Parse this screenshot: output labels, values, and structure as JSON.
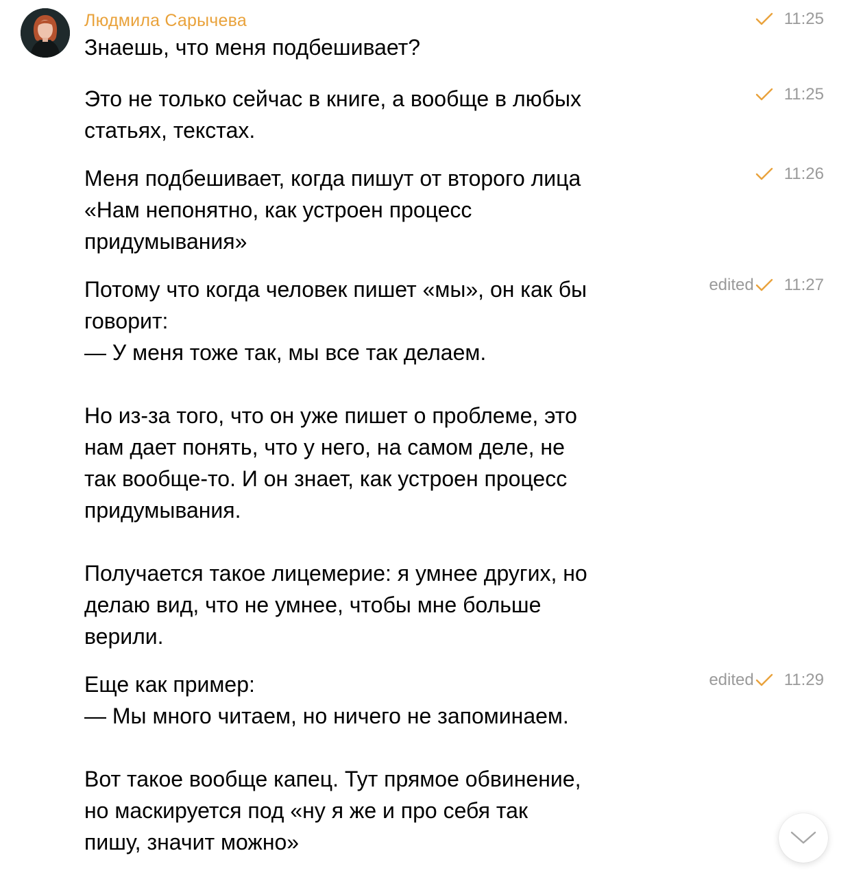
{
  "chat": {
    "sender_name": "Людмила Сарычева",
    "accent_color": "#e9a23b",
    "messages": [
      {
        "text": "Знаешь, что меня подбешивает?",
        "edited": "",
        "time": "11:25",
        "status_icon": "check-icon"
      },
      {
        "text": "Это не только сейчас в книге, а вообще в любых\nстатьях, текстах.",
        "edited": "",
        "time": "11:25",
        "status_icon": "check-icon"
      },
      {
        "text": "Меня подбешивает, когда пишут от второго лица\n«Нам непонятно, как устроен процесс\nпридумывания»",
        "edited": "",
        "time": "11:26",
        "status_icon": "check-icon"
      },
      {
        "text": "Потому что когда человек пишет «мы», он как бы\nговорит:\n— У меня тоже так, мы все так делаем.\n\nНо из-за того, что он уже пишет о проблеме, это\nнам дает понять, что у него, на самом деле, не\nтак вообще-то. И он знает, как устроен процесс\nпридумывания.\n\nПолучается такое лицемерие: я умнее других, но\nделаю вид, что не умнее, чтобы мне больше\nверили.",
        "edited": "edited",
        "time": "11:27",
        "status_icon": "check-icon"
      },
      {
        "text": "Еще как пример:\n— Мы много читаем, но ничего не запоминаем.\n\nВот такое вообще капец. Тут прямое обвинение,\nно маскируется под «ну я же и про себя так\nпишу, значит можно»",
        "edited": "edited",
        "time": "11:29",
        "status_icon": "check-icon"
      }
    ]
  },
  "scroll_button": {
    "icon": "chevron-down-icon"
  }
}
